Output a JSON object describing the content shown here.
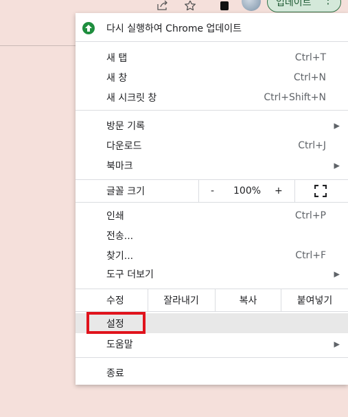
{
  "toolbar": {
    "update_button_label": "업데이트",
    "more_icon": "⋮",
    "icons": [
      "share-icon",
      "star-icon",
      "side-panel-icon",
      "avatar"
    ]
  },
  "menu": {
    "relaunch": {
      "label": "다시 실행하여 Chrome 업데이트",
      "icon": "update-arrow-icon",
      "icon_color": "#1e8e3e"
    },
    "new_tab": {
      "label": "새 탭",
      "shortcut": "Ctrl+T"
    },
    "new_window": {
      "label": "새 창",
      "shortcut": "Ctrl+N"
    },
    "incognito": {
      "label": "새 시크릿 창",
      "shortcut": "Ctrl+Shift+N"
    },
    "history": {
      "label": "방문 기록"
    },
    "downloads": {
      "label": "다운로드",
      "shortcut": "Ctrl+J"
    },
    "bookmarks": {
      "label": "북마크"
    },
    "zoom": {
      "label": "글꼴 크기",
      "minus": "-",
      "value": "100%",
      "plus": "+"
    },
    "print": {
      "label": "인쇄",
      "shortcut": "Ctrl+P"
    },
    "cast": {
      "label": "전송..."
    },
    "find": {
      "label": "찾기...",
      "shortcut": "Ctrl+F"
    },
    "more_tools": {
      "label": "도구 더보기"
    },
    "edit": {
      "label": "수정",
      "cut": "잘라내기",
      "copy": "복사",
      "paste": "붙여넣기"
    },
    "settings": {
      "label": "설정"
    },
    "help": {
      "label": "도움말"
    },
    "exit": {
      "label": "종료"
    },
    "arrow_glyph": "▶"
  },
  "colors": {
    "page_background": "#f5e0db",
    "highlight_border": "#e0131c",
    "hover_background": "#e8e8e8",
    "update_button_bg": "#d4e9da"
  }
}
